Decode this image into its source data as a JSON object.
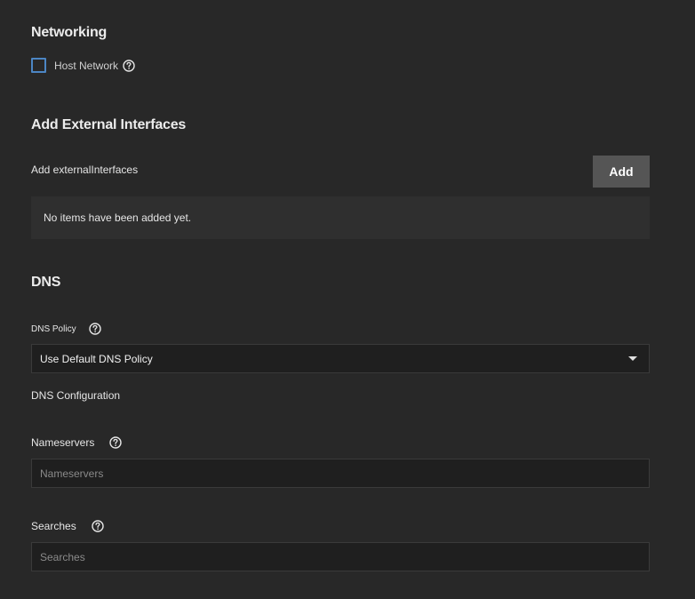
{
  "networking": {
    "title": "Networking",
    "host_network": {
      "label": "Host Network",
      "checked": false
    }
  },
  "external_interfaces": {
    "title": "Add External Interfaces",
    "list_label": "Add externalInterfaces",
    "add_button_label": "Add",
    "empty_message": "No items have been added yet."
  },
  "dns": {
    "title": "DNS",
    "policy": {
      "label": "DNS Policy",
      "selected_value": "Use Default DNS Policy"
    },
    "configuration_label": "DNS Configuration",
    "nameservers": {
      "label": "Nameservers",
      "placeholder": "Nameservers",
      "value": ""
    },
    "searches": {
      "label": "Searches",
      "placeholder": "Searches",
      "value": ""
    }
  },
  "icons": {
    "help": "help-circle-icon",
    "dropdown": "dropdown-arrow-icon"
  },
  "colors": {
    "background": "#282828",
    "input_background": "#1f1f1f",
    "button_background": "#555555",
    "checkbox_border": "#4c86c4"
  }
}
